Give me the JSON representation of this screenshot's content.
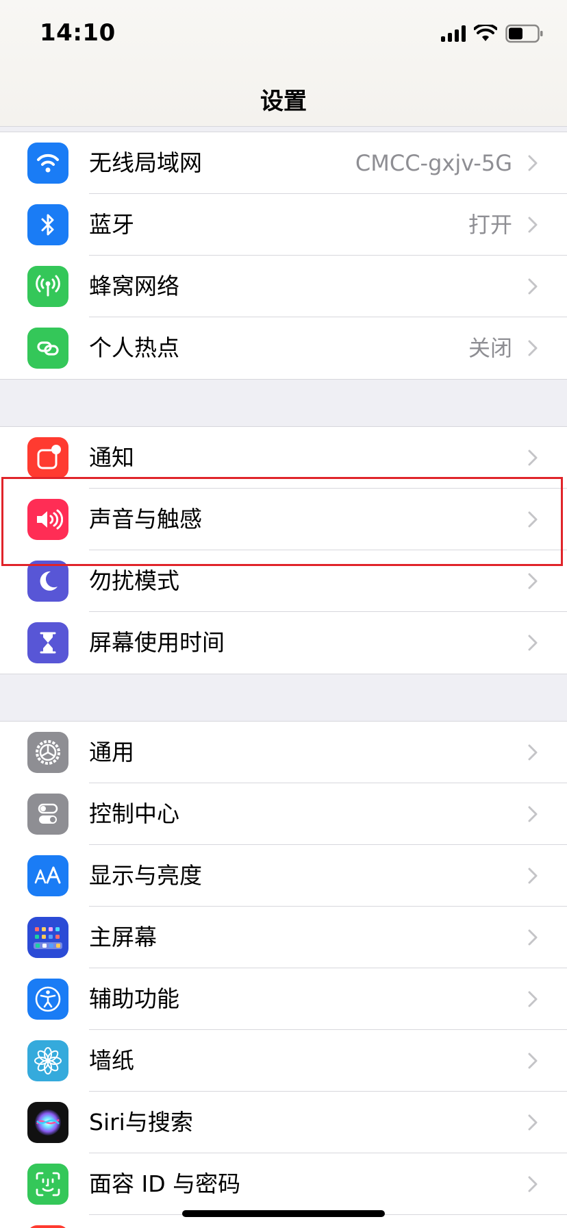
{
  "status_bar": {
    "time": "14:10"
  },
  "nav": {
    "title": "设置"
  },
  "sections": [
    {
      "items": [
        {
          "label": "无线局域网",
          "value": "CMCC-gxjv-5G",
          "icon": "wifi-icon",
          "color": "#1a7cf5"
        },
        {
          "label": "蓝牙",
          "value": "打开",
          "icon": "bluetooth-icon",
          "color": "#1a7cf5"
        },
        {
          "label": "蜂窝网络",
          "value": "",
          "icon": "cellular-icon",
          "color": "#34c759"
        },
        {
          "label": "个人热点",
          "value": "关闭",
          "icon": "hotspot-icon",
          "color": "#34c759"
        }
      ]
    },
    {
      "items": [
        {
          "label": "通知",
          "value": "",
          "icon": "notifications-icon",
          "color": "#ff3b30"
        },
        {
          "label": "声音与触感",
          "value": "",
          "icon": "speaker-icon",
          "color": "#ff2d55"
        },
        {
          "label": "勿扰模式",
          "value": "",
          "icon": "moon-icon",
          "color": "#5856d6"
        },
        {
          "label": "屏幕使用时间",
          "value": "",
          "icon": "hourglass-icon",
          "color": "#5856d6"
        }
      ]
    },
    {
      "items": [
        {
          "label": "通用",
          "value": "",
          "icon": "gear-icon",
          "color": "#8e8e93"
        },
        {
          "label": "控制中心",
          "value": "",
          "icon": "toggles-icon",
          "color": "#8e8e93"
        },
        {
          "label": "显示与亮度",
          "value": "",
          "icon": "text-size-icon",
          "color": "#1a7cf5"
        },
        {
          "label": "主屏幕",
          "value": "",
          "icon": "home-screen-icon",
          "color": "#2b4bd6"
        },
        {
          "label": "辅助功能",
          "value": "",
          "icon": "accessibility-icon",
          "color": "#1a7cf5"
        },
        {
          "label": "墙纸",
          "value": "",
          "icon": "flower-icon",
          "color": "#35aadc"
        },
        {
          "label": "Siri与搜索",
          "value": "",
          "icon": "siri-icon",
          "color": "#222222"
        },
        {
          "label": "面容 ID 与密码",
          "value": "",
          "icon": "face-id-icon",
          "color": "#34c759"
        }
      ]
    }
  ],
  "highlight_color": "#e0242a"
}
